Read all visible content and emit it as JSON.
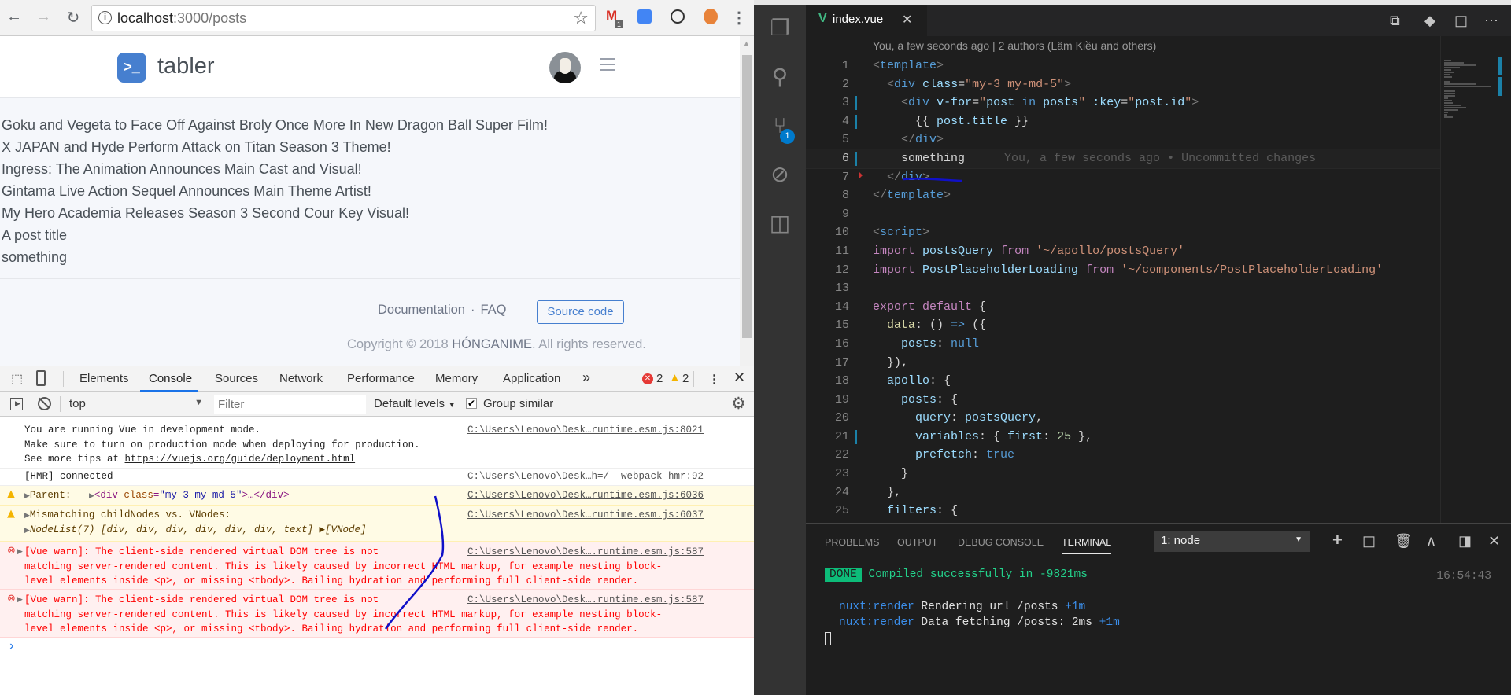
{
  "browser": {
    "url_host": "localhost",
    "url_path": ":3000/posts",
    "ext_badge": "1",
    "brand": "tabler",
    "posts": [
      "Goku and Vegeta to Face Off Against Broly Once More In New Dragon Ball Super Film!",
      "X JAPAN and Hyde Perform Attack on Titan Season 3 Theme!",
      "Ingress: The Animation Announces Main Cast and Visual!",
      "Gintama Live Action Sequel Announces Main Theme Artist!",
      "My Hero Academia Releases Season 3 Second Cour Key Visual!",
      "A post title",
      "something"
    ],
    "footer": {
      "documentation": "Documentation",
      "separator": "·",
      "faq": "FAQ",
      "source_code": "Source code",
      "copyright_prefix": "Copyright © 2018 ",
      "copyright_owner": "HÓNGANIME",
      "copyright_suffix": ". All rights reserved."
    }
  },
  "devtools": {
    "tabs": [
      "Elements",
      "Console",
      "Sources",
      "Network",
      "Performance",
      "Memory",
      "Application"
    ],
    "more": "»",
    "error_count": "2",
    "warning_count": "2",
    "context": "top",
    "filter_placeholder": "Filter",
    "levels": "Default levels",
    "group_similar": "Group similar",
    "group_similar_checked": true,
    "messages": [
      {
        "type": "log",
        "text": "You are running Vue in development mode.\nMake sure to turn on production mode when deploying for production.\nSee more tips at ",
        "link": "https://vuejs.org/guide/deployment.html",
        "source": "C:\\Users\\Lenovo\\Desk…runtime.esm.js:8021"
      },
      {
        "type": "log",
        "text": "[HMR] connected",
        "source": "C:\\Users\\Lenovo\\Desk…h=/__webpack_hmr:92"
      },
      {
        "type": "warn",
        "label": "Parent:",
        "tag_open": "<div ",
        "attr": "class",
        "value": "\"my-3 my-md-5\"",
        "tag_close": ">…</div>",
        "source": "C:\\Users\\Lenovo\\Desk…runtime.esm.js:6036"
      },
      {
        "type": "warn",
        "text": "Mismatching childNodes vs. VNodes:",
        "text2": "NodeList(7) [div, div, div, div, div, div, text] ▶[VNode]",
        "source": "C:\\Users\\Lenovo\\Desk…runtime.esm.js:6037"
      },
      {
        "type": "error",
        "text": "[Vue warn]: The client-side rendered virtual DOM tree is not\nmatching server-rendered content. This is likely caused by incorrect HTML markup, for example nesting block-\nlevel elements inside <p>, or missing <tbody>. Bailing hydration and performing full client-side render.",
        "source": "C:\\Users\\Lenovo\\Desk….runtime.esm.js:587"
      },
      {
        "type": "error",
        "text": "[Vue warn]: The client-side rendered virtual DOM tree is not\nmatching server-rendered content. This is likely caused by incorrect HTML markup, for example nesting block-\nlevel elements inside <p>, or missing <tbody>. Bailing hydration and performing full client-side render.",
        "source": "C:\\Users\\Lenovo\\Desk….runtime.esm.js:587"
      }
    ],
    "prompt": "›"
  },
  "vscode": {
    "tab_name": "index.vue",
    "scm_badge": "1",
    "codelens": "You, a few seconds ago | 2 authors (Lâm Kiều and others)",
    "blame": "You, a few seconds ago • Uncommitted changes",
    "lines": [
      [
        [
          "p",
          "<"
        ],
        [
          "t",
          "template"
        ],
        [
          "p",
          ">"
        ]
      ],
      [
        [
          "w",
          "  "
        ],
        [
          "p",
          "<"
        ],
        [
          "t",
          "div"
        ],
        [
          "w",
          " "
        ],
        [
          "a",
          "class"
        ],
        [
          "w",
          "="
        ],
        [
          "s",
          "\"my-3 my-md-5\""
        ],
        [
          "p",
          ">"
        ]
      ],
      [
        [
          "w",
          "    "
        ],
        [
          "p",
          "<"
        ],
        [
          "t",
          "div"
        ],
        [
          "w",
          " "
        ],
        [
          "a",
          "v-for"
        ],
        [
          "w",
          "="
        ],
        [
          "s",
          "\""
        ],
        [
          "v",
          "post"
        ],
        [
          "w",
          " "
        ],
        [
          "c",
          "in"
        ],
        [
          "w",
          " "
        ],
        [
          "v",
          "posts"
        ],
        [
          "s",
          "\""
        ],
        [
          "w",
          " "
        ],
        [
          "a",
          ":key"
        ],
        [
          "w",
          "="
        ],
        [
          "s",
          "\""
        ],
        [
          "v",
          "post.id"
        ],
        [
          "s",
          "\""
        ],
        [
          "p",
          ">"
        ]
      ],
      [
        [
          "w",
          "      {{ "
        ],
        [
          "v",
          "post.title"
        ],
        [
          "w",
          " }}"
        ]
      ],
      [
        [
          "w",
          "    "
        ],
        [
          "p",
          "</"
        ],
        [
          "t",
          "div"
        ],
        [
          "p",
          ">"
        ]
      ],
      [
        [
          "w",
          "    something"
        ]
      ],
      [
        [
          "w",
          "  "
        ],
        [
          "p",
          "</"
        ],
        [
          "t",
          "div"
        ],
        [
          "p",
          ">"
        ]
      ],
      [
        [
          "p",
          "</"
        ],
        [
          "t",
          "template"
        ],
        [
          "p",
          ">"
        ]
      ],
      [],
      [
        [
          "p",
          "<"
        ],
        [
          "t",
          "script"
        ],
        [
          "p",
          ">"
        ]
      ],
      [
        [
          "k",
          "import"
        ],
        [
          "w",
          " "
        ],
        [
          "v",
          "postsQuery"
        ],
        [
          "w",
          " "
        ],
        [
          "k",
          "from"
        ],
        [
          "w",
          " "
        ],
        [
          "s",
          "'~/apollo/postsQuery'"
        ]
      ],
      [
        [
          "k",
          "import"
        ],
        [
          "w",
          " "
        ],
        [
          "v",
          "PostPlaceholderLoading"
        ],
        [
          "w",
          " "
        ],
        [
          "k",
          "from"
        ],
        [
          "w",
          " "
        ],
        [
          "s",
          "'~/components/PostPlaceholderLoading'"
        ]
      ],
      [],
      [
        [
          "k",
          "export"
        ],
        [
          "w",
          " "
        ],
        [
          "k",
          "default"
        ],
        [
          "w",
          " {"
        ]
      ],
      [
        [
          "w",
          "  "
        ],
        [
          "f",
          "data"
        ],
        [
          "w",
          ": () "
        ],
        [
          "c",
          "=>"
        ],
        [
          "w",
          " ({"
        ]
      ],
      [
        [
          "w",
          "    "
        ],
        [
          "v",
          "posts"
        ],
        [
          "w",
          ": "
        ],
        [
          "c",
          "null"
        ]
      ],
      [
        [
          "w",
          "  }),"
        ]
      ],
      [
        [
          "w",
          "  "
        ],
        [
          "v",
          "apollo"
        ],
        [
          "w",
          ": {"
        ]
      ],
      [
        [
          "w",
          "    "
        ],
        [
          "v",
          "posts"
        ],
        [
          "w",
          ": {"
        ]
      ],
      [
        [
          "w",
          "      "
        ],
        [
          "v",
          "query"
        ],
        [
          "w",
          ": "
        ],
        [
          "v",
          "postsQuery"
        ],
        [
          "w",
          ","
        ]
      ],
      [
        [
          "w",
          "      "
        ],
        [
          "v",
          "variables"
        ],
        [
          "w",
          ": { "
        ],
        [
          "v",
          "first"
        ],
        [
          "w",
          ": "
        ],
        [
          "n",
          "25"
        ],
        [
          "w",
          " },"
        ]
      ],
      [
        [
          "w",
          "      "
        ],
        [
          "v",
          "prefetch"
        ],
        [
          "w",
          ": "
        ],
        [
          "c",
          "true"
        ]
      ],
      [
        [
          "w",
          "    }"
        ]
      ],
      [
        [
          "w",
          "  },"
        ]
      ],
      [
        [
          "w",
          "  "
        ],
        [
          "v",
          "filters"
        ],
        [
          "w",
          ": {"
        ]
      ]
    ],
    "panel": {
      "tabs": [
        "PROBLEMS",
        "OUTPUT",
        "DEBUG CONSOLE",
        "TERMINAL"
      ],
      "terminal_select": "1: node",
      "done": "DONE",
      "compiled": "Compiled successfully in -9821ms",
      "time": "16:54:43",
      "log1_ns": "nuxt:render",
      "log1_text": " Rendering url /posts ",
      "log1_delta": "+1m",
      "log2_ns": "nuxt:render",
      "log2_text": " Data fetching /posts: 2ms ",
      "log2_delta": "+1m"
    }
  },
  "colors": {
    "accent": "#467fcf",
    "vscode_blue": "#007acc",
    "done_green": "#0dbc79",
    "annotation": "#0000cc"
  }
}
